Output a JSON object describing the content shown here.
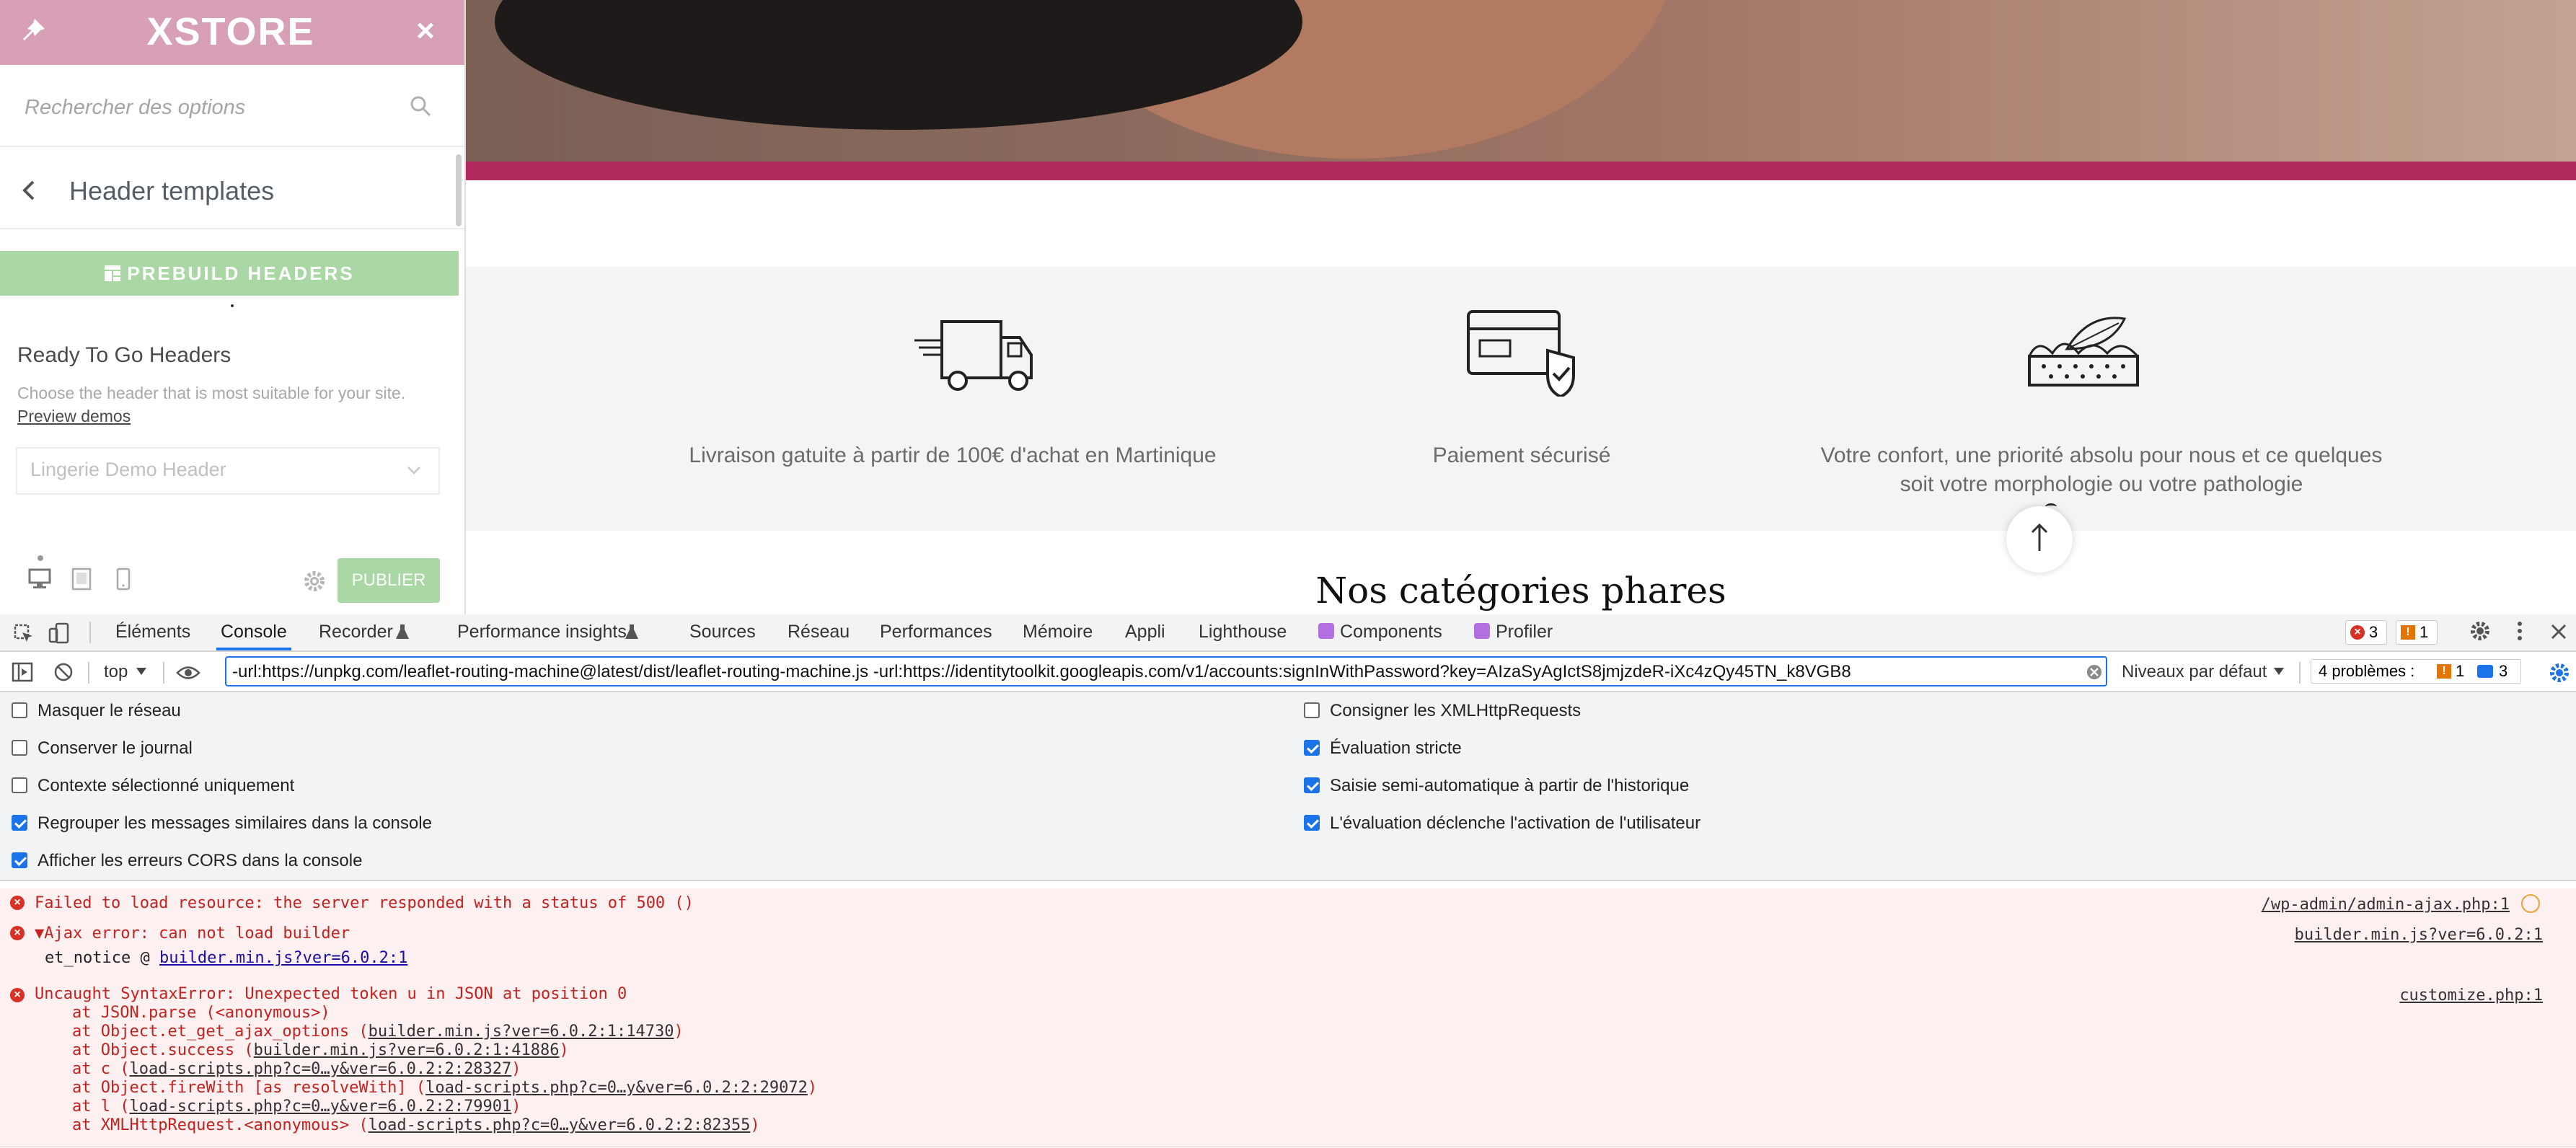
{
  "sidebar": {
    "logo": "XSTORE",
    "close_label": "×",
    "search_placeholder": "Rechercher des options",
    "section_title": "Header templates",
    "prebuild_label": "PREBUILD HEADERS",
    "ready_title": "Ready To Go Headers",
    "ready_desc": "Choose the header that is most suitable for your site.",
    "preview_link": "Preview demos",
    "select_value": "Lingerie Demo Header",
    "publish_label": "PUBLIER"
  },
  "preview": {
    "features": [
      {
        "icon": "delivery-truck-icon",
        "text": "Livraison gatuite à partir de 100€ d'achat en Martinique"
      },
      {
        "icon": "secure-card-icon",
        "text": "Paiement sécurisé"
      },
      {
        "icon": "mattress-icon",
        "text_line1": "Votre confort, une priorité absolu pour nous et ce quelques",
        "text_line2": "soit votre morphologie ou votre pathologie"
      }
    ],
    "categories_title": "Nos catégories phares"
  },
  "devtools": {
    "tabs": [
      "Éléments",
      "Console",
      "Recorder",
      "Performance insights",
      "Sources",
      "Réseau",
      "Performances",
      "Mémoire",
      "Appli",
      "Lighthouse",
      "Components",
      "Profiler"
    ],
    "error_count": "3",
    "warning_count": "1",
    "context": "top",
    "filter_text": "-url:https://unpkg.com/leaflet-routing-machine@latest/dist/leaflet-routing-machine.js -url:https://identitytoolkit.googleapis.com/v1/accounts:signInWithPassword?key=AIzaSyAgIctS8jmjzdeR-iXc4zQy45TN_k8VGB8",
    "levels": "Niveaux par défaut",
    "issues_label": "4 problèmes :",
    "issues_warn": "1",
    "issues_info": "3",
    "settings_left": [
      {
        "label": "Masquer le réseau",
        "checked": false
      },
      {
        "label": "Conserver le journal",
        "checked": false
      },
      {
        "label": "Contexte sélectionné uniquement",
        "checked": false
      },
      {
        "label": "Regrouper les messages similaires dans la console",
        "checked": true
      },
      {
        "label": "Afficher les erreurs CORS dans la console",
        "checked": true
      }
    ],
    "settings_right": [
      {
        "label": "Consigner les XMLHttpRequests",
        "checked": false
      },
      {
        "label": "Évaluation stricte",
        "checked": true
      },
      {
        "label": "Saisie semi-automatique à partir de l'historique",
        "checked": true
      },
      {
        "label": "L'évaluation déclenche l'activation de l'utilisateur",
        "checked": true
      }
    ],
    "logs": {
      "msg1": "Failed to load resource: the server responded with a status of 500 ()",
      "src1": "/wp-admin/admin-ajax.php:1",
      "msg2": "▼Ajax error: can not load builder",
      "src2": "builder.min.js?ver=6.0.2:1",
      "msg2_sub": "et_notice @ ",
      "msg2_link": "builder.min.js?ver=6.0.2:1",
      "msg3": "Uncaught SyntaxError: Unexpected token u in JSON at position 0",
      "src3": "customize.php:1",
      "stack": [
        {
          "pre": "at JSON.parse (<anonymous>)",
          "link": "",
          "post": ""
        },
        {
          "pre": "at Object.et_get_ajax_options (",
          "link": "builder.min.js?ver=6.0.2:1:14730",
          "post": ")"
        },
        {
          "pre": "at Object.success (",
          "link": "builder.min.js?ver=6.0.2:1:41886",
          "post": ")"
        },
        {
          "pre": "at c (",
          "link": "load-scripts.php?c=0…y&ver=6.0.2:2:28327",
          "post": ")"
        },
        {
          "pre": "at Object.fireWith [as resolveWith] (",
          "link": "load-scripts.php?c=0…y&ver=6.0.2:2:29072",
          "post": ")"
        },
        {
          "pre": "at l (",
          "link": "load-scripts.php?c=0…y&ver=6.0.2:2:79901",
          "post": ")"
        },
        {
          "pre": "at XMLHttpRequest.<anonymous> (",
          "link": "load-scripts.php?c=0…y&ver=6.0.2:2:82355",
          "post": ")"
        }
      ]
    }
  }
}
